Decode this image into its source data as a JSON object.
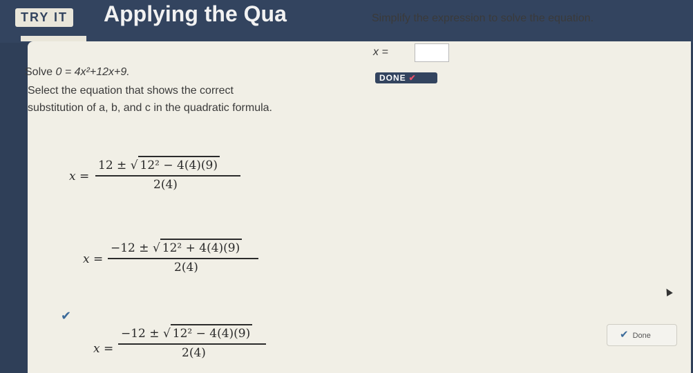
{
  "header": {
    "badge": "TRY IT",
    "title": "Applying the Qua"
  },
  "left": {
    "solve_prefix": "Solve",
    "equation": "0 = 4x²+12x+9.",
    "instruction_line1": "Select the equation that shows the correct",
    "instruction_line2": "substitution of a, b, and c in the quadratic formula."
  },
  "right": {
    "prompt": "Simplify the expression to solve the equation.",
    "answer_label": "x =",
    "answer_value": "",
    "done_badge": "DONE",
    "done_check": "✔"
  },
  "options": [
    {
      "lhs": "x =",
      "numerator": "12 ±",
      "radicand": "12² − 4(4)(9)",
      "denominator": "2(4)",
      "selected": false
    },
    {
      "lhs": "x =",
      "numerator": "−12 ±",
      "radicand": "12² + 4(4)(9)",
      "denominator": "2(4)",
      "selected": false
    },
    {
      "lhs": "x =",
      "numerator": "−12 ±",
      "radicand": "12² − 4(4)(9)",
      "denominator": "2(4)",
      "selected": true
    }
  ],
  "selected_check": "✔",
  "done_button": {
    "icon": "✔",
    "label": "Done"
  },
  "colors": {
    "navy": "#33445f",
    "paper": "#f1efe6",
    "accent_check": "#3c6b9a",
    "badge_check": "#e8526a"
  }
}
